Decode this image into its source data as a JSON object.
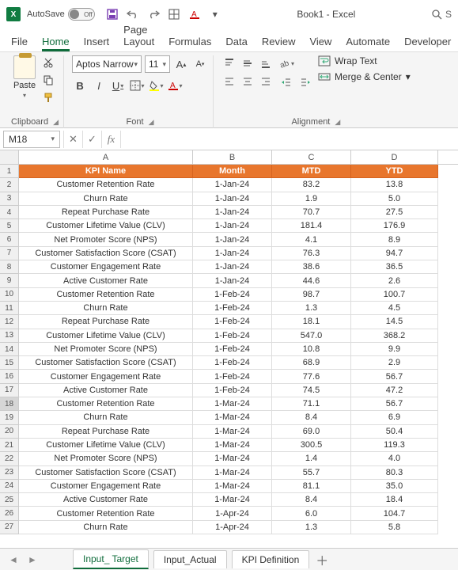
{
  "titlebar": {
    "autosave_label": "AutoSave",
    "autosave_state": "Off",
    "doc_title": "Book1 - Excel",
    "search_placeholder": "S"
  },
  "tabs": {
    "file": "File",
    "home": "Home",
    "insert": "Insert",
    "page_layout": "Page Layout",
    "formulas": "Formulas",
    "data": "Data",
    "review": "Review",
    "view": "View",
    "automate": "Automate",
    "developer": "Developer"
  },
  "ribbon": {
    "clipboard": {
      "paste_label": "Paste",
      "group_label": "Clipboard"
    },
    "font": {
      "font_name": "Aptos Narrow",
      "font_size": "11",
      "group_label": "Font",
      "bold": "B",
      "italic": "I",
      "underline": "U"
    },
    "alignment": {
      "group_label": "Alignment",
      "wrap": "Wrap Text",
      "merge": "Merge & Center"
    }
  },
  "formula_bar": {
    "name_box": "M18",
    "formula": ""
  },
  "grid": {
    "col_headers": [
      "A",
      "B",
      "C",
      "D"
    ],
    "header_row": [
      "KPI Name",
      "Month",
      "MTD",
      "YTD"
    ],
    "rows": [
      {
        "n": 2,
        "a": "Customer Retention Rate",
        "b": "1-Jan-24",
        "c": "83.2",
        "d": "13.8"
      },
      {
        "n": 3,
        "a": "Churn Rate",
        "b": "1-Jan-24",
        "c": "1.9",
        "d": "5.0"
      },
      {
        "n": 4,
        "a": "Repeat Purchase Rate",
        "b": "1-Jan-24",
        "c": "70.7",
        "d": "27.5"
      },
      {
        "n": 5,
        "a": "Customer Lifetime Value (CLV)",
        "b": "1-Jan-24",
        "c": "181.4",
        "d": "176.9"
      },
      {
        "n": 6,
        "a": "Net Promoter Score (NPS)",
        "b": "1-Jan-24",
        "c": "4.1",
        "d": "8.9"
      },
      {
        "n": 7,
        "a": "Customer Satisfaction Score (CSAT)",
        "b": "1-Jan-24",
        "c": "76.3",
        "d": "94.7"
      },
      {
        "n": 8,
        "a": "Customer Engagement Rate",
        "b": "1-Jan-24",
        "c": "38.6",
        "d": "36.5"
      },
      {
        "n": 9,
        "a": "Active Customer Rate",
        "b": "1-Jan-24",
        "c": "44.6",
        "d": "2.6"
      },
      {
        "n": 10,
        "a": "Customer Retention Rate",
        "b": "1-Feb-24",
        "c": "98.7",
        "d": "100.7"
      },
      {
        "n": 11,
        "a": "Churn Rate",
        "b": "1-Feb-24",
        "c": "1.3",
        "d": "4.5"
      },
      {
        "n": 12,
        "a": "Repeat Purchase Rate",
        "b": "1-Feb-24",
        "c": "18.1",
        "d": "14.5"
      },
      {
        "n": 13,
        "a": "Customer Lifetime Value (CLV)",
        "b": "1-Feb-24",
        "c": "547.0",
        "d": "368.2"
      },
      {
        "n": 14,
        "a": "Net Promoter Score (NPS)",
        "b": "1-Feb-24",
        "c": "10.8",
        "d": "9.9"
      },
      {
        "n": 15,
        "a": "Customer Satisfaction Score (CSAT)",
        "b": "1-Feb-24",
        "c": "68.9",
        "d": "2.9"
      },
      {
        "n": 16,
        "a": "Customer Engagement Rate",
        "b": "1-Feb-24",
        "c": "77.6",
        "d": "56.7"
      },
      {
        "n": 17,
        "a": "Active Customer Rate",
        "b": "1-Feb-24",
        "c": "74.5",
        "d": "47.2"
      },
      {
        "n": 18,
        "a": "Customer Retention Rate",
        "b": "1-Mar-24",
        "c": "71.1",
        "d": "56.7"
      },
      {
        "n": 19,
        "a": "Churn Rate",
        "b": "1-Mar-24",
        "c": "8.4",
        "d": "6.9"
      },
      {
        "n": 20,
        "a": "Repeat Purchase Rate",
        "b": "1-Mar-24",
        "c": "69.0",
        "d": "50.4"
      },
      {
        "n": 21,
        "a": "Customer Lifetime Value (CLV)",
        "b": "1-Mar-24",
        "c": "300.5",
        "d": "119.3"
      },
      {
        "n": 22,
        "a": "Net Promoter Score (NPS)",
        "b": "1-Mar-24",
        "c": "1.4",
        "d": "4.0"
      },
      {
        "n": 23,
        "a": "Customer Satisfaction Score (CSAT)",
        "b": "1-Mar-24",
        "c": "55.7",
        "d": "80.3"
      },
      {
        "n": 24,
        "a": "Customer Engagement Rate",
        "b": "1-Mar-24",
        "c": "81.1",
        "d": "35.0"
      },
      {
        "n": 25,
        "a": "Active Customer Rate",
        "b": "1-Mar-24",
        "c": "8.4",
        "d": "18.4"
      },
      {
        "n": 26,
        "a": "Customer Retention Rate",
        "b": "1-Apr-24",
        "c": "6.0",
        "d": "104.7"
      },
      {
        "n": 27,
        "a": "Churn Rate",
        "b": "1-Apr-24",
        "c": "1.3",
        "d": "5.8"
      }
    ]
  },
  "sheets": {
    "tab1": "Input_ Target",
    "tab2": "Input_Actual",
    "tab3": "KPI Definition"
  }
}
